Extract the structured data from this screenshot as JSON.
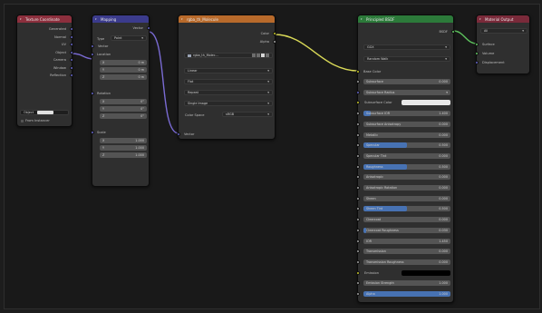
{
  "colors": {
    "input_header": "#8c2f3d",
    "vector_header": "#3b3b8c",
    "texture_header": "#b86a2b",
    "shader_header": "#2c7a3a",
    "output_header": "#7a2a3a",
    "socket_vector": "#6363c7",
    "socket_color": "#c7c729",
    "socket_gray": "#a1a1a1",
    "socket_shader": "#63c763",
    "link_vector": "#7a6bd4",
    "link_color": "#d9d957",
    "link_shader": "#5ec45e"
  },
  "texcoord": {
    "title": "Texture Coordinate",
    "outputs": [
      "Generated",
      "Normal",
      "UV",
      "Object",
      "Camera",
      "Window",
      "Reflection"
    ],
    "object_label": "Object",
    "from_instancer": "From Instancer"
  },
  "mapping": {
    "title": "Mapping",
    "output": "Vector",
    "type_label": "Type",
    "type_value": "Point",
    "vector_label": "Vector",
    "location_label": "Location",
    "location": [
      [
        "X",
        "0 m"
      ],
      [
        "Y",
        "0 m"
      ],
      [
        "Z",
        "0 m"
      ]
    ],
    "rotation_label": "Rotation",
    "rotation": [
      [
        "X",
        "0°"
      ],
      [
        "Y",
        "0°"
      ],
      [
        "Z",
        "0°"
      ]
    ],
    "scale_label": "Scale",
    "scale": [
      [
        "X",
        "1.000"
      ],
      [
        "Y",
        "1.000"
      ],
      [
        "Z",
        "1.000"
      ]
    ]
  },
  "image_texture": {
    "title": "rgba_th_Molecule",
    "outputs": [
      "Color",
      "Alpha"
    ],
    "image_name": "rgba_th_Molec...",
    "interpolation": "Linear",
    "projection": "Flat",
    "extension": "Repeat",
    "source": "Single Image",
    "colorspace_label": "Color Space",
    "colorspace_value": "sRGB",
    "vector_input": "Vector"
  },
  "bsdf": {
    "title": "Principled BSDF",
    "output": "BSDF",
    "distribution": "GGX",
    "subsurface_method": "Random Walk",
    "base_color": "Base Color",
    "rows": [
      {
        "label": "Subsurface",
        "value": "0.000",
        "fill": 0
      },
      {
        "label": "Subsurface Radius",
        "value": "",
        "fill": 0,
        "dropdown": true
      },
      {
        "label": "Subsurface Color",
        "value": "",
        "fill": 0,
        "swatch": "#e8e8e8"
      },
      {
        "label": "Subsurface IOR",
        "value": "1.400",
        "fill": 0.08
      },
      {
        "label": "Subsurface Anisotropy",
        "value": "0.000",
        "fill": 0
      },
      {
        "label": "Metallic",
        "value": "0.000",
        "fill": 0
      },
      {
        "label": "Specular",
        "value": "0.500",
        "fill": 0.5
      },
      {
        "label": "Specular Tint",
        "value": "0.000",
        "fill": 0
      },
      {
        "label": "Roughness",
        "value": "0.500",
        "fill": 0.5
      },
      {
        "label": "Anisotropic",
        "value": "0.000",
        "fill": 0
      },
      {
        "label": "Anisotropic Rotation",
        "value": "0.000",
        "fill": 0
      },
      {
        "label": "Sheen",
        "value": "0.000",
        "fill": 0
      },
      {
        "label": "Sheen Tint",
        "value": "0.500",
        "fill": 0.5
      },
      {
        "label": "Clearcoat",
        "value": "0.000",
        "fill": 0
      },
      {
        "label": "Clearcoat Roughness",
        "value": "0.030",
        "fill": 0.03
      },
      {
        "label": "IOR",
        "value": "1.450",
        "fill": 0
      },
      {
        "label": "Transmission",
        "value": "0.000",
        "fill": 0
      },
      {
        "label": "Transmission Roughness",
        "value": "0.000",
        "fill": 0
      },
      {
        "label": "Emission",
        "value": "",
        "fill": 0,
        "swatch": "#000000"
      },
      {
        "label": "Emission Strength",
        "value": "1.000",
        "fill": 0
      },
      {
        "label": "Alpha",
        "value": "1.000",
        "fill": 1
      }
    ]
  },
  "output": {
    "title": "Material Output",
    "target": "All",
    "inputs": [
      "Surface",
      "Volume",
      "Displacement"
    ]
  }
}
